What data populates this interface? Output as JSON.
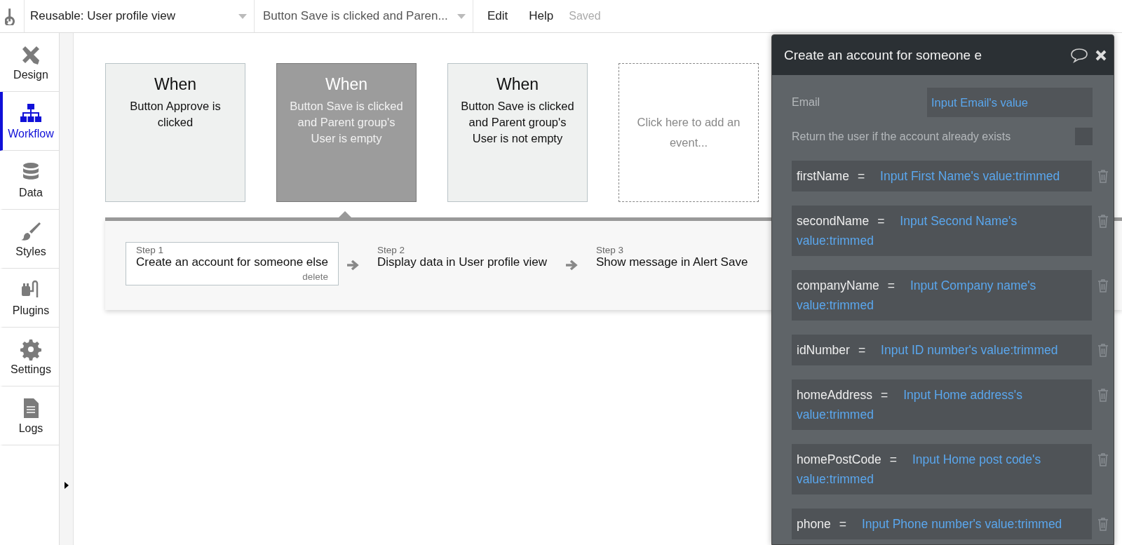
{
  "top_bar": {
    "page_dropdown": "Reusable: User profile view",
    "workflow_dropdown": "Button Save is clicked and Paren...",
    "menu": [
      "Edit",
      "Help"
    ],
    "status": "Saved"
  },
  "sidebar": {
    "items": [
      {
        "label": "Design",
        "selected": false
      },
      {
        "label": "Workflow",
        "selected": true
      },
      {
        "label": "Data",
        "selected": false
      },
      {
        "label": "Styles",
        "selected": false
      },
      {
        "label": "Plugins",
        "selected": false
      },
      {
        "label": "Settings",
        "selected": false
      },
      {
        "label": "Logs",
        "selected": false
      }
    ]
  },
  "events": [
    {
      "kind": "event",
      "title": "When",
      "text": "Button Approve is clicked",
      "selected": false
    },
    {
      "kind": "event",
      "title": "When",
      "text": "Button Save is clicked and Parent group's User is empty",
      "selected": true
    },
    {
      "kind": "event",
      "title": "When",
      "text": "Button Save is clicked and Parent group's User is not empty",
      "selected": false
    },
    {
      "kind": "add",
      "text": "Click here to add an event...",
      "selected": false
    }
  ],
  "steps": [
    {
      "step": "Step 1",
      "action": "Create an account for someone else",
      "delete": "delete",
      "selected": true
    },
    {
      "step": "Step 2",
      "action": "Display data in User profile view",
      "selected": false
    },
    {
      "step": "Step 3",
      "action": "Show message in Alert Save",
      "selected": false
    }
  ],
  "panel": {
    "title": "Create an account for someone e",
    "email": {
      "label": "Email",
      "value": "Input Email's value"
    },
    "return_user": {
      "label": "Return the user if the account already exists",
      "checked": false
    },
    "fields": [
      {
        "key": "firstName",
        "operator": "=",
        "value": "Input First Name's value:trimmed"
      },
      {
        "key": "secondName",
        "operator": "=",
        "value": "Input Second Name's value:trimmed"
      },
      {
        "key": "companyName",
        "operator": "=",
        "value": "Input Company name's value:trimmed"
      },
      {
        "key": "idNumber",
        "operator": "=",
        "value": "Input ID number's value:trimmed"
      },
      {
        "key": "homeAddress",
        "operator": "=",
        "value": "Input Home address's value:trimmed"
      },
      {
        "key": "homePostCode",
        "operator": "=",
        "value": "Input Home post code's value:trimmed"
      },
      {
        "key": "phone",
        "operator": "=",
        "value": "Input Phone number's value:trimmed"
      }
    ]
  }
}
